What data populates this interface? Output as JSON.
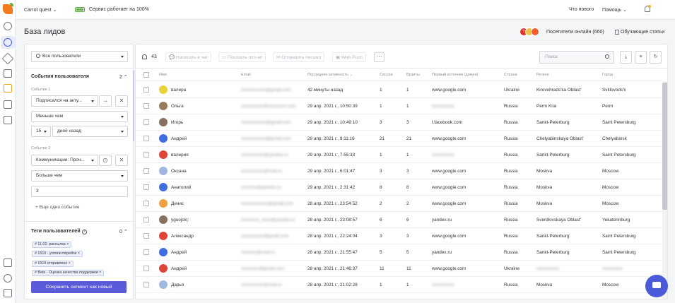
{
  "topbar": {
    "project": "Carrot quest",
    "status": "Сервис работает на 100%",
    "whats_new": "Что нового",
    "help": "Помощь"
  },
  "page": {
    "title": "База лидов",
    "online_label": "Посетители онлайн (660)",
    "guides": "Обучающие статьи",
    "online_avatars": [
      "Т",
      "",
      ""
    ]
  },
  "filters": {
    "all_users": "Все пользователи",
    "events_title": "События пользователя",
    "events_count": "2",
    "event1_label": "Событие 1",
    "event1_select": "Подписался на акту...",
    "event1_cond": "Меньше чем",
    "event1_num": "15",
    "event1_period": "дней назад",
    "event2_label": "Событие 2",
    "event2_select": "Коммуникации: Проч...",
    "event2_cond": "Больше чем",
    "event2_value": "3",
    "add_event": "+ Еще одно событие",
    "tags_title": "Теги пользователей",
    "tags_count": "0",
    "tags": [
      "11.02. рассылка",
      "1510 - успели перейти",
      "1510 отправлено",
      "Beta - Оценка качества поддержки"
    ],
    "save_button": "Сохранить сегмент как новый"
  },
  "toolbar": {
    "count": "43",
    "write_chat": "Написать в чат",
    "send_popup": "Показать поп-ап",
    "send_email": "Отправить письмо",
    "web_push": "Web Push",
    "more": "···",
    "search_placeholder": "Поиск"
  },
  "table": {
    "headers": [
      "Имя",
      "Email",
      "Последняя активность",
      "Сессии",
      "Визиты",
      "Первый источник (домен)",
      "Страна",
      "Регион",
      "Город"
    ],
    "rows": [
      {
        "name": "валера",
        "email": "xxxxxxxxxxx@gmail.com",
        "last": "42 минуты назад",
        "sessions": "1",
        "visits": "1",
        "source": "www.google.com",
        "country": "Ukraine",
        "region": "Kirovohrads'ka Oblast'",
        "city": "Svitlovods'k",
        "color": "#e8d33a"
      },
      {
        "name": "Ольга",
        "email": "xxxxxxxxxx@xxxxxxxx.com",
        "last": "29 апр. 2021 г., 10:50:39",
        "sessions": "1",
        "visits": "1",
        "source": "xxxxxxxxxx",
        "country": "Russia",
        "region": "Perm Krai",
        "city": "Perm",
        "color": "#9a7a5a"
      },
      {
        "name": "Игорь",
        "email": "xxxxxxxxxxx@gmail.com",
        "last": "29 апр. 2021 г., 10:49:10",
        "sessions": "3",
        "visits": "3",
        "source": "l.facebook.com",
        "country": "Russia",
        "region": "Sankt-Peterburg",
        "city": "Saint Petersburg",
        "color": "#8a7060"
      },
      {
        "name": "Андрей",
        "email": "xxxxxxxxxxx@gmail.com",
        "last": "29 апр. 2021 г., 9:11:16",
        "sessions": "21",
        "visits": "21",
        "source": "www.google.com",
        "country": "Russia",
        "region": "Chelyabinskaya Oblast'",
        "city": "Chelyabinsk",
        "color": "#3f6ee0"
      },
      {
        "name": "валерия",
        "email": "xxxxxxxxxx@yandex.ru",
        "last": "29 апр. 2021 г., 7:55:33",
        "sessions": "1",
        "visits": "1",
        "source": "xxxxxxxxxx",
        "country": "Russia",
        "region": "Sankt-Peterburg",
        "city": "Saint Petersburg",
        "color": "#e0453a"
      },
      {
        "name": "Оксана",
        "email": "xxxxxxxxxx@mail.ru",
        "last": "29 апр. 2021 г., 6:01:47",
        "sessions": "3",
        "visits": "3",
        "source": "www.google.com",
        "country": "Russia",
        "region": "Moskva",
        "city": "Moscow",
        "color": "#a0b8e0"
      },
      {
        "name": "Анатолий",
        "email": "xxxxxxx@yandex.ru",
        "last": "29 апр. 2021 г., 2:31:42",
        "sessions": "8",
        "visits": "8",
        "source": "www.google.com",
        "country": "Russia",
        "region": "Moskva",
        "city": "Moscow",
        "color": "#3f6ee0"
      },
      {
        "name": "Денис",
        "email": "xxxxxxxxxxxx@gmail.com",
        "last": "28 апр. 2021 г., 23:54:52",
        "sessions": "2",
        "visits": "2",
        "source": "www.google.com",
        "country": "Russia",
        "region": "Moskva",
        "city": "Moscow",
        "color": "#f0a040"
      },
      {
        "name": "yguojck(:",
        "email": "xxxxxxxx_xxxx@yandex.ru",
        "last": "28 апр. 2021 г., 23:08:57",
        "sessions": "6",
        "visits": "6",
        "source": "yandex.ru",
        "country": "Russia",
        "region": "Sverdlovskaya Oblast'",
        "city": "Yekaterinburg",
        "color": "#8a7060"
      },
      {
        "name": "Александр",
        "email": "xxxxxxxxxx@gmail.com",
        "last": "28 апр. 2021 г., 22:24:04",
        "sessions": "3",
        "visits": "3",
        "source": "www.google.com",
        "country": "Russia",
        "region": "Sankt-Peterburg",
        "city": "Saint Petersburg",
        "color": "#e0453a"
      },
      {
        "name": "Андрей",
        "email": "xxxxxxx@mail.ru",
        "last": "28 апр. 2021 г., 21:55:47",
        "sessions": "5",
        "visits": "5",
        "source": "yandex.ru",
        "country": "Russia",
        "region": "Sankt-Peterburg",
        "city": "Saint Petersburg",
        "color": "#3f6ee0"
      },
      {
        "name": "Андрей",
        "email": "xxxxxxxx@gmail.com",
        "last": "28 апр. 2021 г., 21:46:37",
        "sessions": "11",
        "visits": "11",
        "source": "www.google.com",
        "country": "Ukraine",
        "region": "xxxxxxxxxx",
        "city": "xxxxxxxxx",
        "color": "#e0453a"
      },
      {
        "name": "Дарья",
        "email": "xxxxxxxxxx@mail.ru",
        "last": "28 апр. 2021 г., 21:02:28",
        "sessions": "1",
        "visits": "1",
        "source": "xxxxxxxxxx",
        "country": "Russia",
        "region": "Moskva",
        "city": "Moscow",
        "color": "#a0b8e0"
      }
    ]
  }
}
